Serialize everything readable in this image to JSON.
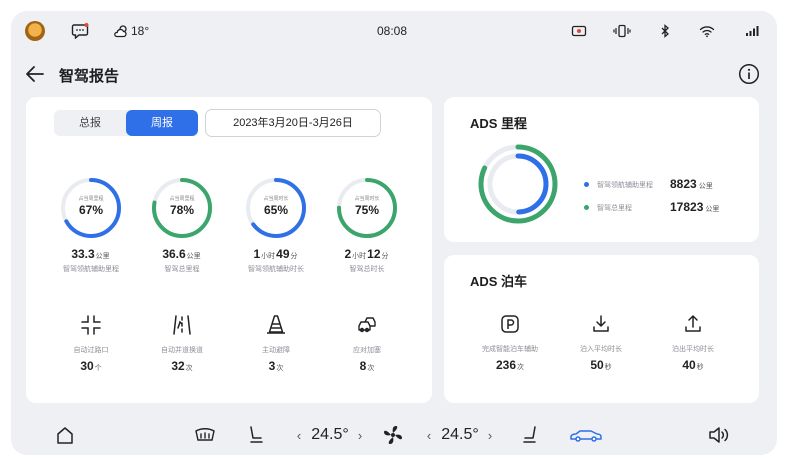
{
  "status_bar": {
    "weather": "18°",
    "time": "08:08"
  },
  "header": {
    "title": "智驾报告"
  },
  "report": {
    "tabs": [
      {
        "label": "总报",
        "active": false
      },
      {
        "label": "周报",
        "active": true
      }
    ],
    "date_range": "2023年3月20日-3月26日",
    "rings": [
      {
        "sublabel": "占当周里程",
        "value": "67%",
        "percent": 67,
        "color": "#2f6fe8",
        "stat_num": "33.3",
        "stat_unit": "公里",
        "label": "智驾领航辅助里程"
      },
      {
        "sublabel": "占当周里程",
        "value": "78%",
        "percent": 78,
        "color": "#3ba56b",
        "stat_num": "36.6",
        "stat_unit": "公里",
        "label": "智驾总里程"
      },
      {
        "sublabel": "占当周时长",
        "value": "65%",
        "percent": 65,
        "color": "#2f6fe8",
        "stat_h": "1",
        "stat_hu": "小时",
        "stat_m": "49",
        "stat_mu": "分",
        "label": "智驾领航辅助时长"
      },
      {
        "sublabel": "占当周时长",
        "value": "75%",
        "percent": 75,
        "color": "#3ba56b",
        "stat_h": "2",
        "stat_hu": "小时",
        "stat_m": "12",
        "stat_mu": "分",
        "label": "智驾总时长"
      }
    ],
    "features": [
      {
        "icon": "intersection-icon",
        "label": "自动过路口",
        "value": "30",
        "unit": "个"
      },
      {
        "icon": "lane-change-icon",
        "label": "自动并道换道",
        "value": "32",
        "unit": "次"
      },
      {
        "icon": "traffic-cone-icon",
        "label": "主动避障",
        "value": "3",
        "unit": "次"
      },
      {
        "icon": "cut-in-icon",
        "label": "应对加塞",
        "value": "8",
        "unit": "次"
      }
    ]
  },
  "mileage": {
    "title": "ADS 里程",
    "items": [
      {
        "label": "智驾领航辅助里程",
        "value": "8823",
        "unit": "公里",
        "color": "#2f6fe8"
      },
      {
        "label": "智驾总里程",
        "value": "17823",
        "unit": "公里",
        "color": "#3ba56b"
      }
    ]
  },
  "parking": {
    "title": "ADS 泊车",
    "items": [
      {
        "icon": "parking-icon",
        "label": "完成智能泊车辅助",
        "value": "236",
        "unit": "次"
      },
      {
        "icon": "park-in-icon",
        "label": "泊入平均时长",
        "value": "50",
        "unit": "秒"
      },
      {
        "icon": "park-out-icon",
        "label": "泊出平均时长",
        "value": "40",
        "unit": "秒"
      }
    ]
  },
  "dock": {
    "left_temp": "24.5°",
    "right_temp": "24.5°",
    "chevron_left": "‹",
    "chevron_right": "›",
    "accent": "#2f6fe8"
  }
}
